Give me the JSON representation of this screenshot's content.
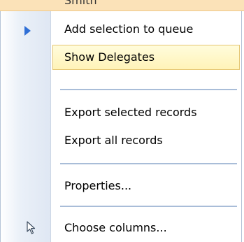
{
  "grid_row": {
    "text": "Smith"
  },
  "menu": {
    "items": [
      {
        "label": "Add selection to queue",
        "icon": "play-arrow-icon"
      },
      {
        "label": "Show Delegates",
        "highlighted": true
      },
      {
        "label": "Export selected records"
      },
      {
        "label": "Export all records"
      },
      {
        "label": "Properties..."
      },
      {
        "label": "Choose columns...",
        "icon": "cursor-icon"
      }
    ]
  },
  "colors": {
    "highlight_bg": "#fff3b8",
    "highlight_border": "#e4c571",
    "selected_row_bg": "#fbe2b8",
    "separator": "#a9bdd8",
    "arrow": "#2f6fd6"
  }
}
